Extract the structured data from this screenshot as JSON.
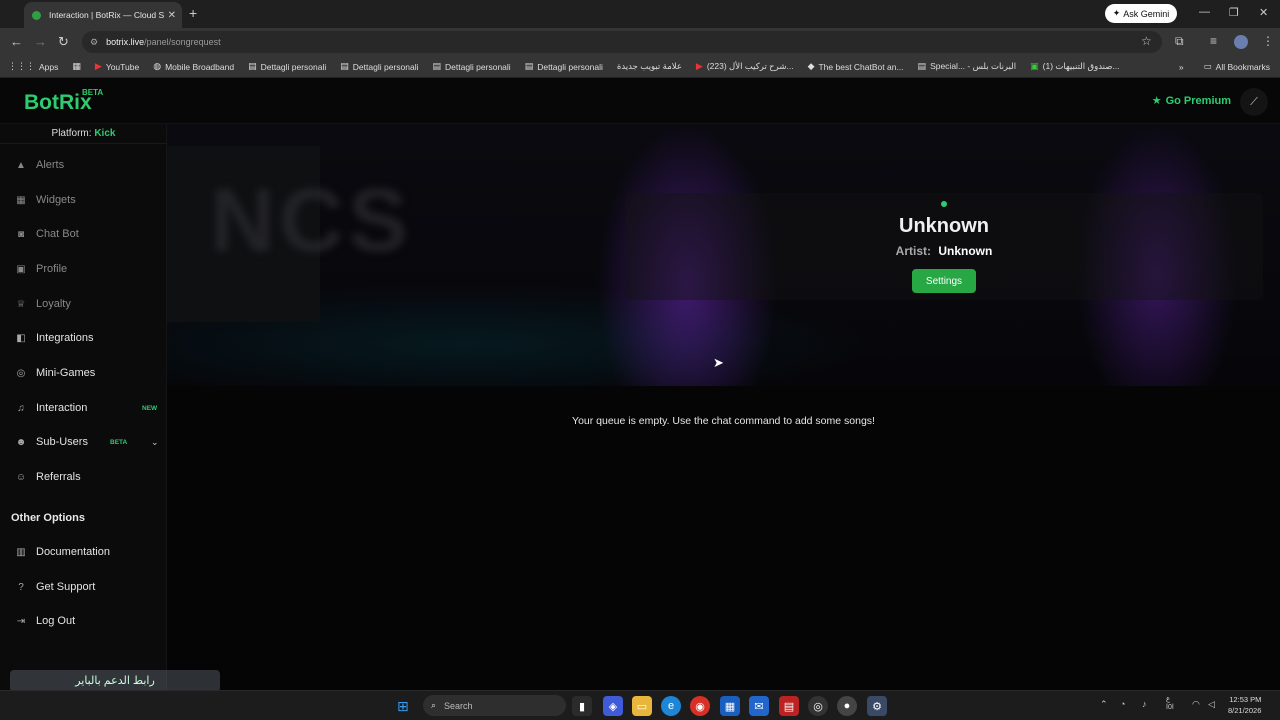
{
  "browser": {
    "tab_title": "Interaction | BotRix — Cloud St",
    "tab_close": "✕",
    "new_tab": "+",
    "ask_gemini": "Ask Gemini",
    "url_host": "botrix.live",
    "url_path": "/panel/songrequest",
    "bookmarks": [
      {
        "label": "Apps",
        "icon": "grid-icon"
      },
      {
        "label": "YouTube",
        "icon": "youtube-icon"
      },
      {
        "label": "Mobile Broadband",
        "icon": "globe-icon"
      },
      {
        "label": "Dettagli personali",
        "icon": "page-icon"
      },
      {
        "label": "Dettagli personali",
        "icon": "page-icon"
      },
      {
        "label": "Dettagli personali",
        "icon": "page-icon"
      },
      {
        "label": "Dettagli personali",
        "icon": "page-icon"
      },
      {
        "label": "علامة تبويب جديدة",
        "icon": "page-icon"
      },
      {
        "label": "(223) شرح تركيب الأل...",
        "icon": "youtube-icon"
      },
      {
        "label": "The best ChatBot an...",
        "icon": "diamond-icon"
      },
      {
        "label": "Special... - البرنات بلس",
        "icon": "page-icon"
      },
      {
        "label": "(1) صندوق التنبيهات...",
        "icon": "page-icon"
      }
    ],
    "all_bookmarks": "All Bookmarks"
  },
  "app": {
    "logo": "BotRix",
    "logo_badge": "BETA",
    "go_premium": "Go Premium",
    "accent_color": "#2ecc71"
  },
  "sidebar": {
    "platform_label": "Platform:",
    "platform_value": "Kick",
    "items": [
      {
        "label": "Alerts",
        "icon": "warning-icon",
        "dim": true
      },
      {
        "label": "Widgets",
        "icon": "widgets-icon",
        "dim": true
      },
      {
        "label": "Chat Bot",
        "icon": "robot-icon",
        "dim": true
      },
      {
        "label": "Profile",
        "icon": "profile-icon",
        "dim": true
      },
      {
        "label": "Loyalty",
        "icon": "trophy-icon",
        "dim": true
      },
      {
        "label": "Integrations",
        "icon": "integrations-icon",
        "dim": false
      },
      {
        "label": "Mini-Games",
        "icon": "gamepad-icon",
        "dim": false
      },
      {
        "label": "Interaction",
        "icon": "music-icon",
        "dim": false,
        "badge": "NEW"
      },
      {
        "label": "Sub-Users",
        "icon": "users-icon",
        "dim": false,
        "badge": "BETA"
      },
      {
        "label": "Referrals",
        "icon": "referrals-icon",
        "dim": false
      }
    ],
    "other_options_title": "Other Options",
    "other_items": [
      {
        "label": "Documentation",
        "icon": "book-icon"
      },
      {
        "label": "Get Support",
        "icon": "question-icon"
      },
      {
        "label": "Log Out",
        "icon": "logout-icon"
      }
    ],
    "watermark": "رابط الدعم بالباير"
  },
  "player": {
    "title": "Unknown",
    "artist_label": "Artist:",
    "artist_value": "Unknown",
    "settings_label": "Settings",
    "album_art_text": "NCS"
  },
  "queue": {
    "empty_message": "Your queue is empty. Use the chat command to add some songs!"
  },
  "taskbar": {
    "search_placeholder": "Search",
    "time": "12:53 PM",
    "date": "8/21/2026",
    "lang": "ع\nا0ا"
  }
}
